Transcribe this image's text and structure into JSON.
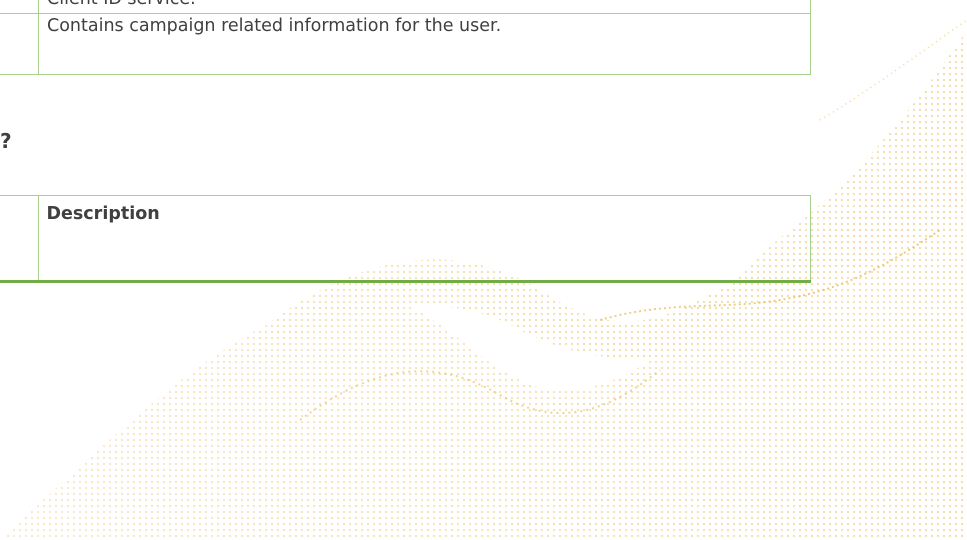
{
  "top_table": {
    "rows": [
      {
        "col1": "",
        "col2": "Client ID service."
      },
      {
        "col1": "",
        "col2": "Contains campaign related information for the user."
      }
    ]
  },
  "section": {
    "heading": "?"
  },
  "bottom_table": {
    "header": {
      "col1": "",
      "col2": "Description"
    }
  },
  "decoration": {
    "wave_icon": "dotted-wave-background",
    "wave_color": "#e8b84a"
  }
}
